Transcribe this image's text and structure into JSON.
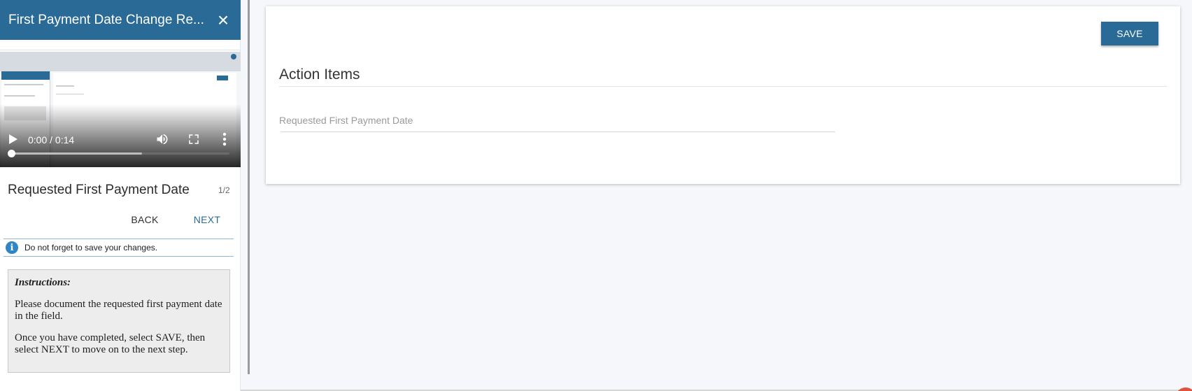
{
  "panel": {
    "title": "First Payment Date Change Re...",
    "close_label": "×"
  },
  "video": {
    "time": "0:00 / 0:14",
    "buffered_fraction": 0.6,
    "progress_fraction": 0.0,
    "icons": [
      "play-icon",
      "volume-icon",
      "fullscreen-icon",
      "more-vert-icon"
    ]
  },
  "step": {
    "title": "Requested First Payment Date",
    "count": "1/2",
    "back_label": "BACK",
    "next_label": "NEXT"
  },
  "notice": {
    "icon": "i",
    "text": "Do not forget to save your changes."
  },
  "instructions": {
    "heading": "Instructions:",
    "paragraphs": [
      "Please document the requested first payment date in the field.",
      "Once you have completed, select SAVE, then select NEXT to move on to the next step."
    ]
  },
  "main": {
    "save_label": "SAVE",
    "section_title": "Action Items",
    "field_label": "Requested First Payment Date",
    "field_value": ""
  },
  "colors": {
    "brand": "#2a6a96",
    "info": "#2f86c6",
    "background": "#f5f7fb"
  }
}
